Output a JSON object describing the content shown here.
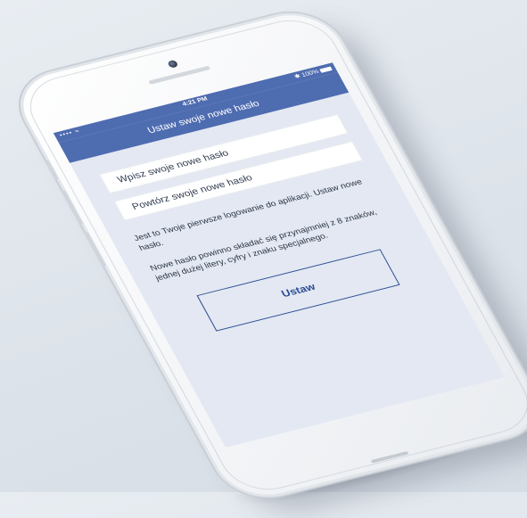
{
  "status_bar": {
    "carrier": "•••• ≈",
    "time": "4:21 PM",
    "battery_text": "✱ 100%"
  },
  "header": {
    "title": "Ustaw swoje nowe hasło"
  },
  "form": {
    "new_password_placeholder": "Wpisz swoje nowe hasło",
    "repeat_password_placeholder": "Powtórz swoje nowe hasło",
    "first_login_info": "Jest to Twoje pierwsze logowanie do aplikacji. Ustaw nowe hasło.",
    "password_rules": "Nowe hasło powinno składać się przynajmniej z 8 znaków, jednej dużej litery, cyfry i znaku specjalnego.",
    "submit_label": "Ustaw"
  },
  "colors": {
    "header_bg": "#4e6cb0",
    "screen_bg": "#e3e8f2",
    "button_border": "#2e4f94"
  }
}
